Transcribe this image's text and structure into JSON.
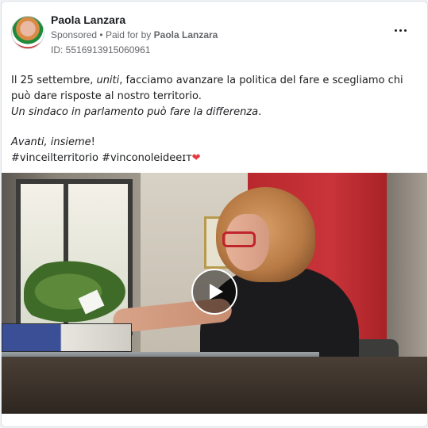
{
  "post": {
    "author": "Paola Lanzara",
    "sponsored": "Sponsored",
    "separator": "•",
    "paid_for_prefix": "Paid for by",
    "paid_for_name": "Paola Lanzara",
    "id_label": "ID: 5516913915060961",
    "more_icon": "more-horizontal-icon"
  },
  "body": {
    "line1_pre": "Il 25 settembre, ",
    "line1_italic": "uniti",
    "line1_post": ", facciamo avanzare la politica del fare e scegliamo chi può dare risposte al nostro territorio.",
    "line2_italic": "Un sindaco in parlamento può fare la differenza",
    "line2_post": ".",
    "line3_italic": "Avanti, insieme",
    "line3_post": "!",
    "hashtags": "#vinceilterritorio #vinconoleideeɪᴛ",
    "heart": "❤"
  },
  "media": {
    "type": "video",
    "play_icon": "play-icon"
  },
  "colors": {
    "text": "#1c1e21",
    "meta": "#65676b",
    "heart": "#e8373e"
  }
}
